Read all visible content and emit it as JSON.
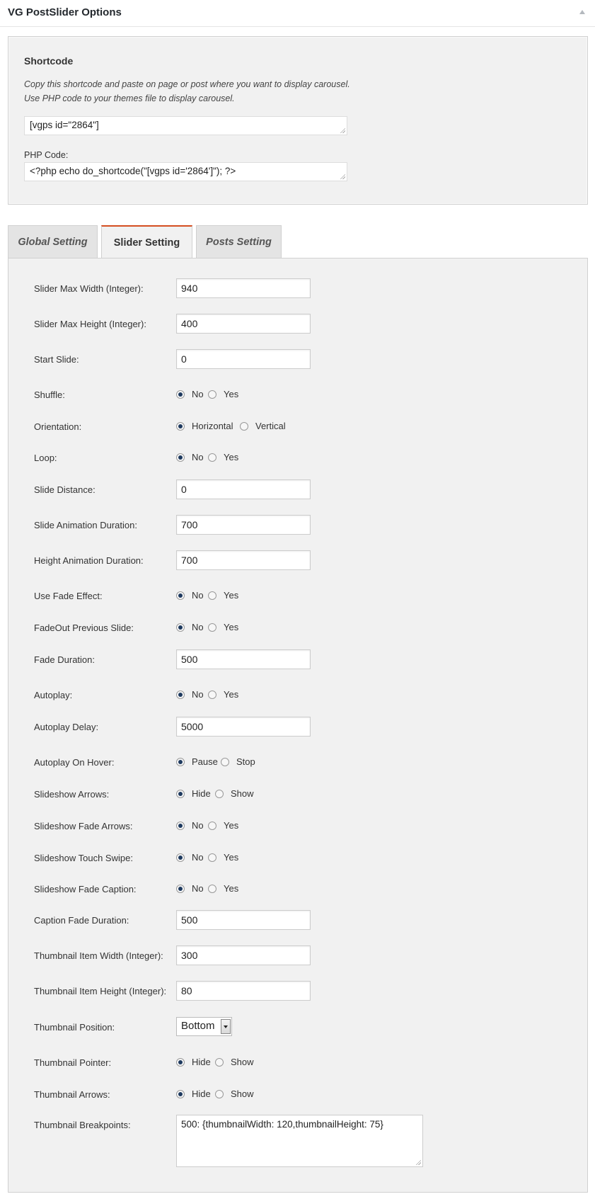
{
  "metabox": {
    "title": "VG PostSlider Options"
  },
  "shortcode": {
    "heading": "Shortcode",
    "desc_line1": "Copy this shortcode and paste on page or post where you want to display carousel.",
    "desc_line2": "Use PHP code to your themes file to display carousel.",
    "shortcode_value": "[vgps id=\"2864\"]",
    "php_label": "PHP Code:",
    "php_value": "<?php echo do_shortcode(\"[vgps id='2864']\"); ?>"
  },
  "tabs": [
    {
      "label": "Global Setting",
      "active": false
    },
    {
      "label": "Slider Setting",
      "active": true
    },
    {
      "label": "Posts Setting",
      "active": false
    }
  ],
  "settings": {
    "max_width": {
      "label": "Slider Max Width (Integer):",
      "value": "940"
    },
    "max_height": {
      "label": "Slider Max Height (Integer):",
      "value": "400"
    },
    "start_slide": {
      "label": "Start Slide:",
      "value": "0"
    },
    "shuffle": {
      "label": "Shuffle:",
      "opt1": "No",
      "opt2": "Yes",
      "selected": "No"
    },
    "orientation": {
      "label": "Orientation:",
      "opt1": "Horizontal",
      "opt2": "Vertical",
      "selected": "Horizontal"
    },
    "loop": {
      "label": "Loop:",
      "opt1": "No",
      "opt2": "Yes",
      "selected": "No"
    },
    "slide_distance": {
      "label": "Slide Distance:",
      "value": "0"
    },
    "slide_anim_duration": {
      "label": "Slide Animation Duration:",
      "value": "700"
    },
    "height_anim_duration": {
      "label": "Height Animation Duration:",
      "value": "700"
    },
    "use_fade": {
      "label": "Use Fade Effect:",
      "opt1": "No",
      "opt2": "Yes",
      "selected": "No"
    },
    "fadeout_prev": {
      "label": "FadeOut Previous Slide:",
      "opt1": "No",
      "opt2": "Yes",
      "selected": "No"
    },
    "fade_duration": {
      "label": "Fade Duration:",
      "value": "500"
    },
    "autoplay": {
      "label": "Autoplay:",
      "opt1": "No",
      "opt2": "Yes",
      "selected": "No"
    },
    "autoplay_delay": {
      "label": "Autoplay Delay:",
      "value": "5000"
    },
    "autoplay_hover": {
      "label": "Autoplay On Hover:",
      "opt1": "Pause",
      "opt2": "Stop",
      "selected": "Pause"
    },
    "slideshow_arrows": {
      "label": "Slideshow Arrows:",
      "opt1": "Hide",
      "opt2": "Show",
      "selected": "Hide"
    },
    "slideshow_fade_arrows": {
      "label": "Slideshow Fade Arrows:",
      "opt1": "No",
      "opt2": "Yes",
      "selected": "No"
    },
    "slideshow_touch": {
      "label": "Slideshow Touch Swipe:",
      "opt1": "No",
      "opt2": "Yes",
      "selected": "No"
    },
    "slideshow_fade_caption": {
      "label": "Slideshow Fade Caption:",
      "opt1": "No",
      "opt2": "Yes",
      "selected": "No"
    },
    "caption_fade_duration": {
      "label": "Caption Fade Duration:",
      "value": "500"
    },
    "thumb_width": {
      "label": "Thumbnail Item Width (Integer):",
      "value": "300"
    },
    "thumb_height": {
      "label": "Thumbnail Item Height (Integer):",
      "value": "80"
    },
    "thumb_position": {
      "label": "Thumbnail Position:",
      "value": "Bottom"
    },
    "thumb_pointer": {
      "label": "Thumbnail Pointer:",
      "opt1": "Hide",
      "opt2": "Show",
      "selected": "Hide"
    },
    "thumb_arrows": {
      "label": "Thumbnail Arrows:",
      "opt1": "Hide",
      "opt2": "Show",
      "selected": "Hide"
    },
    "thumb_breakpoints": {
      "label": "Thumbnail Breakpoints:",
      "value": "500: {thumbnailWidth: 120,thumbnailHeight: 75}"
    }
  }
}
